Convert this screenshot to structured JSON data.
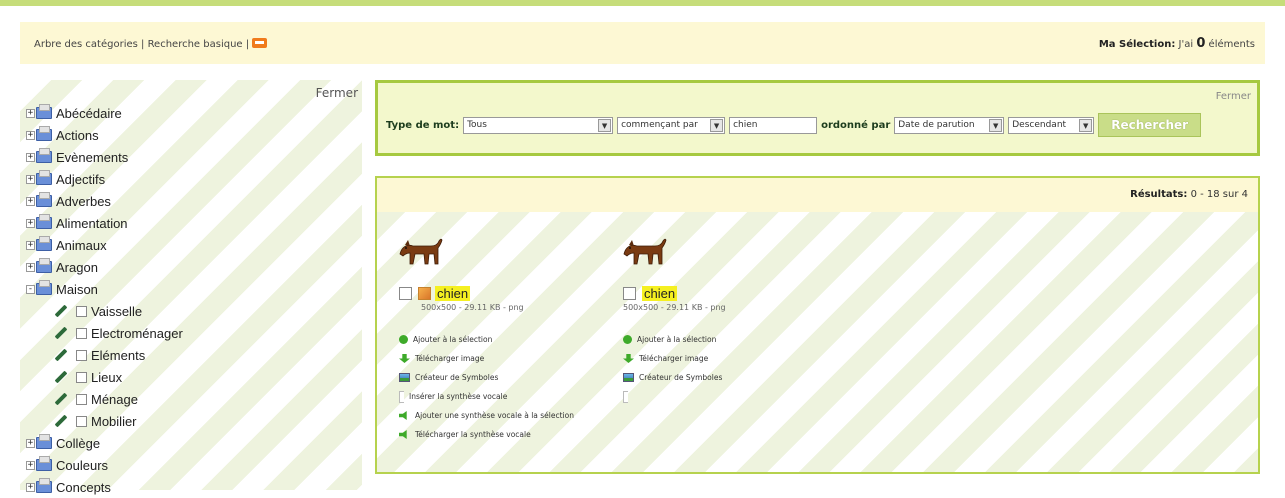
{
  "topbar": {
    "link_tree": "Arbre des catégories",
    "separator": " | ",
    "link_basic": "Recherche basique",
    "selection_label": "Ma Sélection:",
    "selection_prefix": "J'ai",
    "selection_count": "0",
    "selection_suffix": "éléments"
  },
  "left": {
    "close": "Fermer",
    "categories": [
      {
        "label": "Abécédaire",
        "state": "+"
      },
      {
        "label": "Actions",
        "state": "+"
      },
      {
        "label": "Evènements",
        "state": "+"
      },
      {
        "label": "Adjectifs",
        "state": "+"
      },
      {
        "label": "Adverbes",
        "state": "+"
      },
      {
        "label": "Alimentation",
        "state": "+"
      },
      {
        "label": "Animaux",
        "state": "+"
      },
      {
        "label": "Aragon",
        "state": "+"
      },
      {
        "label": "Maison",
        "state": "-"
      }
    ],
    "children": [
      "Vaisselle",
      "Electroménager",
      "Eléments",
      "Lieux",
      "Ménage",
      "Mobilier"
    ],
    "after": [
      {
        "label": "Collège",
        "state": "+"
      },
      {
        "label": "Couleurs",
        "state": "+"
      },
      {
        "label": "Concepts",
        "state": "+"
      }
    ]
  },
  "search": {
    "close": "Fermer",
    "type_label": "Type de mot:",
    "type_value": "Tous",
    "match_value": "commençant par",
    "query": "chien",
    "order_label": "ordonné par",
    "order_value": "Date de parution",
    "direction_value": "Descendant",
    "submit": "Rechercher"
  },
  "results": {
    "label": "Résultats:",
    "range": "0 - 18 sur 4",
    "items": [
      {
        "word": "chien",
        "meta": "500x500 - 29.11 KB - png",
        "actions": [
          "Ajouter à la sélection",
          "Télécharger image",
          "Créateur de Symboles",
          "Insérer la synthèse vocale",
          "Ajouter une synthèse vocale à la sélection",
          "Télécharger la synthèse vocale"
        ]
      },
      {
        "word": "chien",
        "meta": "500x500 - 29.11 KB - png",
        "actions": [
          "Ajouter à la sélection",
          "Télécharger image",
          "Créateur de Symboles"
        ]
      }
    ]
  }
}
